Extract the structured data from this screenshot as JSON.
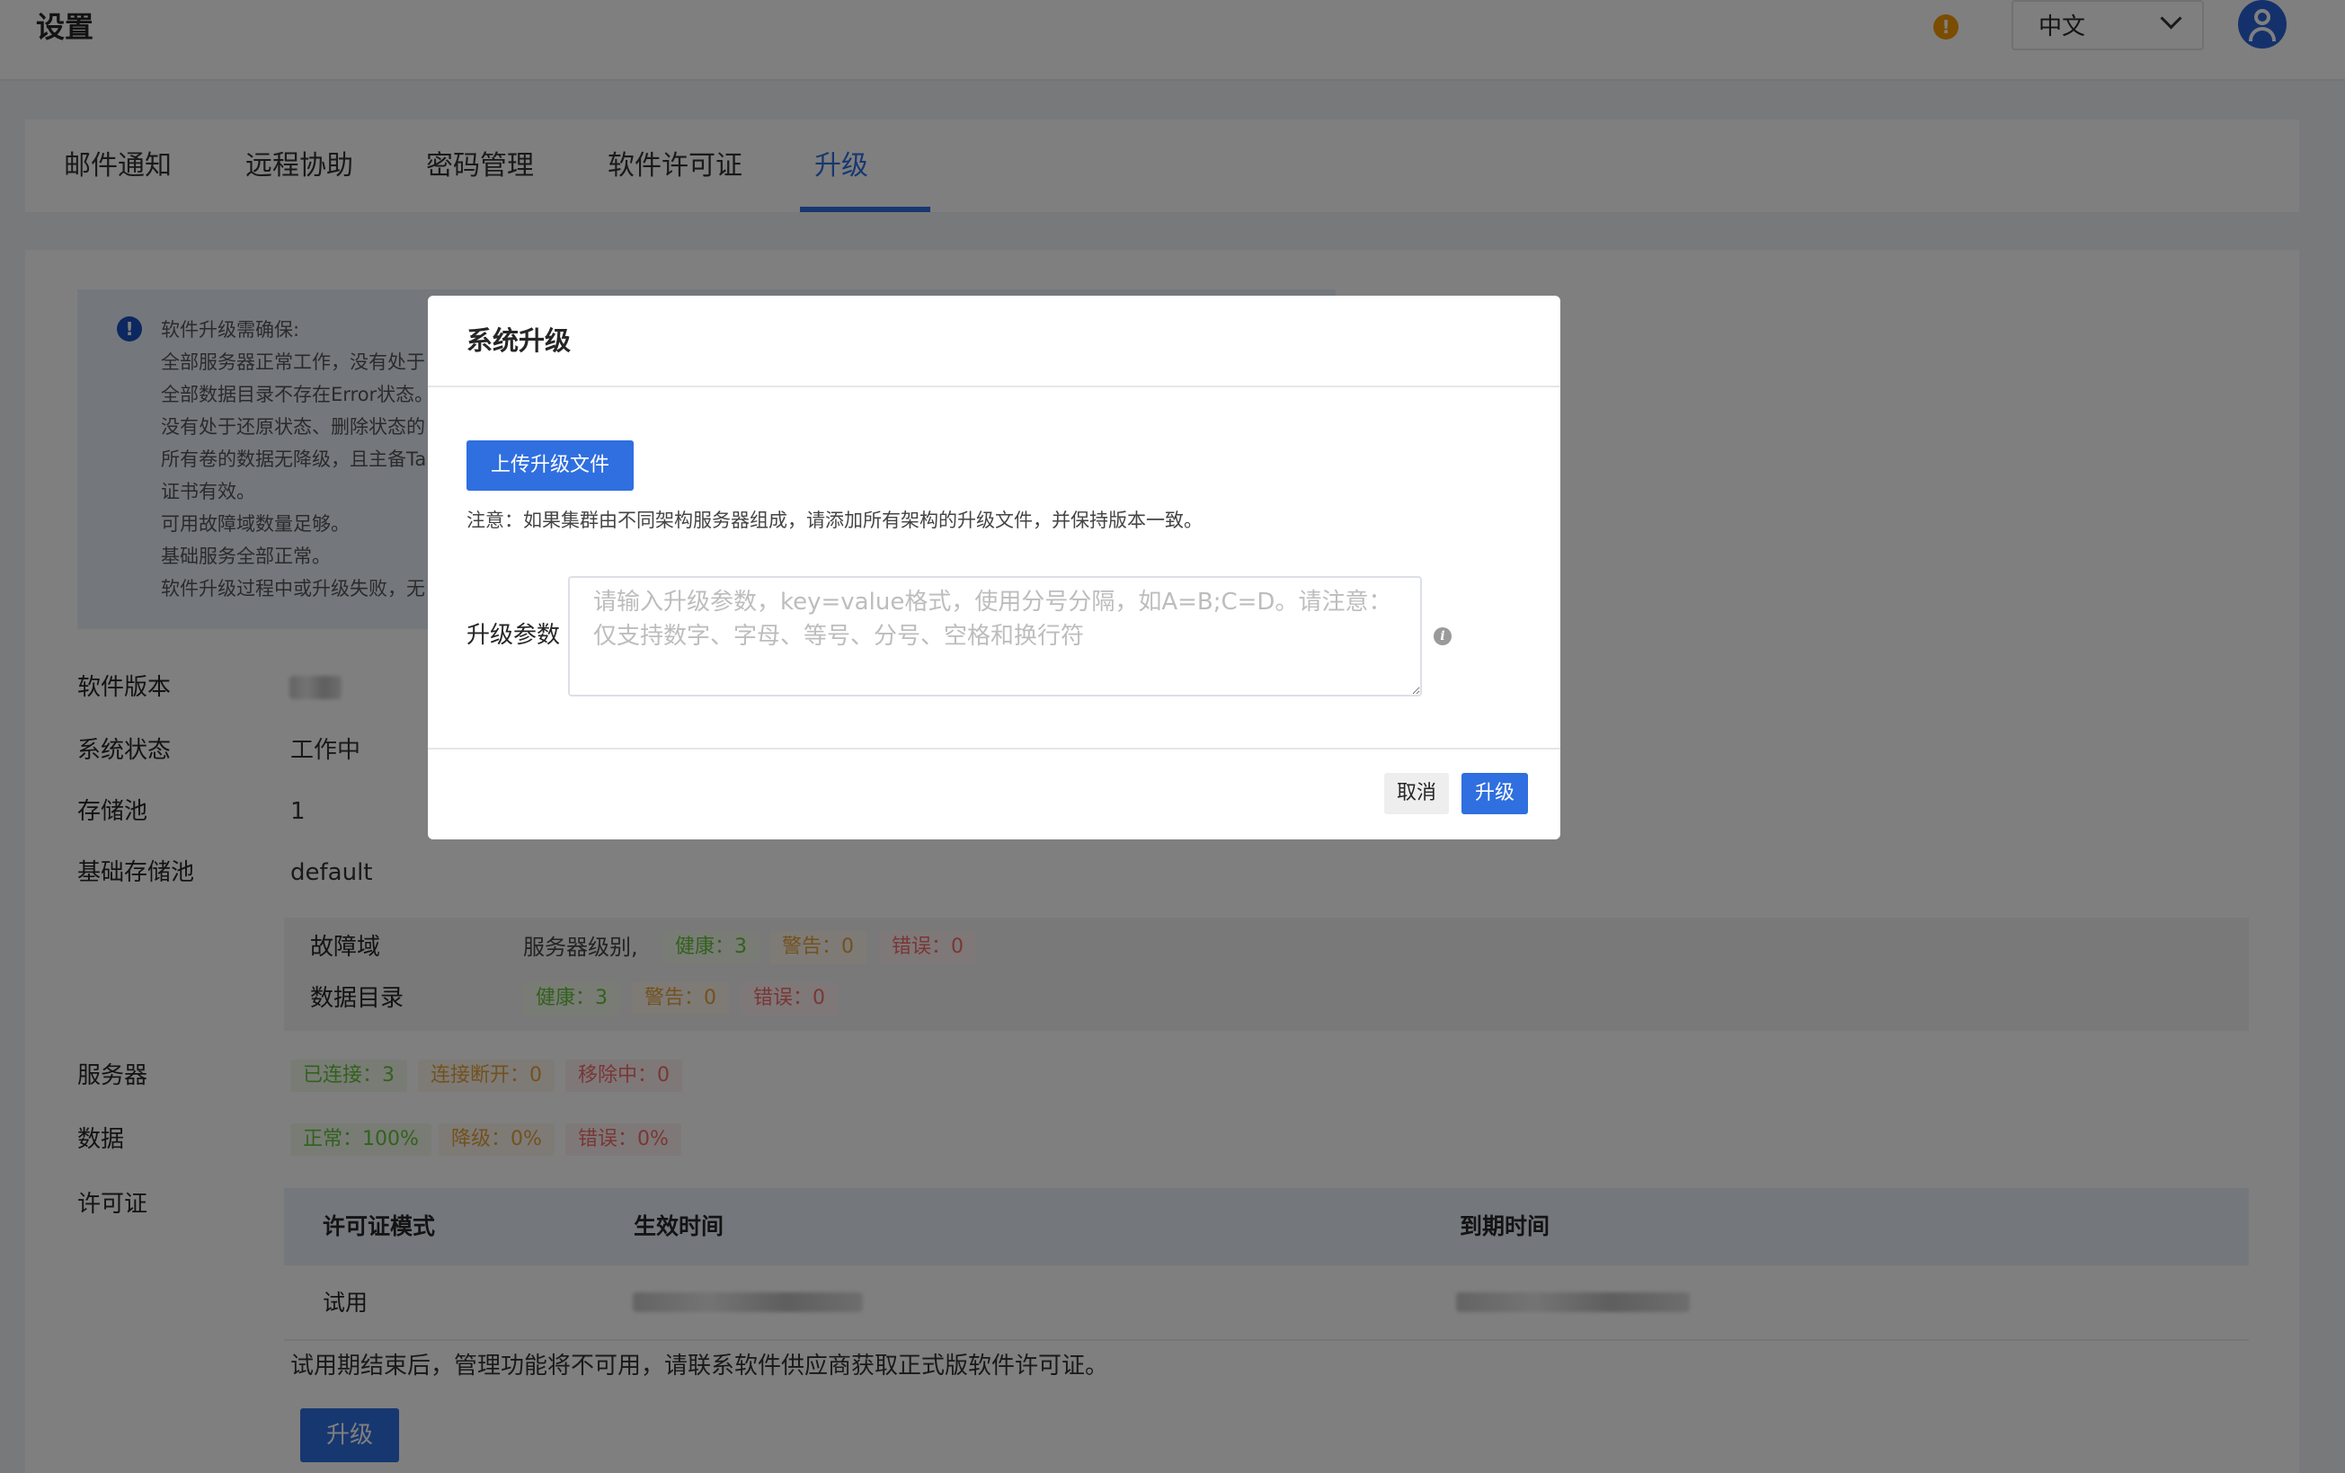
{
  "header": {
    "title": "设置",
    "language": "中文"
  },
  "tabs": [
    {
      "label": "邮件通知"
    },
    {
      "label": "远程协助"
    },
    {
      "label": "密码管理"
    },
    {
      "label": "软件许可证"
    },
    {
      "label": "升级",
      "active": true
    }
  ],
  "notice": {
    "lines": [
      "软件升级需确保:",
      "全部服务器正常工作，没有处于",
      "全部数据目录不存在Error状态。",
      "没有处于还原状态、删除状态的",
      "所有卷的数据无降级，且主备Ta",
      "证书有效。",
      "可用故障域数量足够。",
      "基础服务全部正常。",
      "软件升级过程中或升级失败，无"
    ]
  },
  "info": {
    "version_label": "软件版本",
    "status_label": "系统状态",
    "status_value": "工作中",
    "pool_label": "存储池",
    "pool_value": "1",
    "base_pool_label": "基础存储池",
    "base_pool_value": "default",
    "fault_domain_label": "故障域",
    "fault_domain_level": "服务器级别,",
    "fault_healthy": "健康：3",
    "fault_warning": "警告：0",
    "fault_error": "错误：0",
    "data_dir_label": "数据目录",
    "dir_healthy": "健康：3",
    "dir_warning": "警告：0",
    "dir_error": "错误：0",
    "server_label": "服务器",
    "server_connected": "已连接：3",
    "server_disconnected": "连接断开：0",
    "server_removing": "移除中：0",
    "data_label": "数据",
    "data_normal": "正常：100%",
    "data_degraded": "降级：0%",
    "data_error": "错误：0%",
    "license_label": "许可证"
  },
  "license_table": {
    "headers": [
      "许可证模式",
      "生效时间",
      "到期时间"
    ],
    "row": {
      "mode": "试用"
    }
  },
  "trial_note": "试用期结束后，管理功能将不可用，请联系软件供应商获取正式版软件许可证。",
  "upgrade_button": "升级",
  "modal": {
    "title": "系统升级",
    "upload_button": "上传升级文件",
    "note": "注意：如果集群由不同架构服务器组成，请添加所有架构的升级文件，并保持版本一致。",
    "param_label": "升级参数",
    "param_placeholder": "请输入升级参数，key=value格式，使用分号分隔，如A=B;C=D。请注意：仅支持数字、字母、等号、分号、空格和换行符",
    "cancel_button": "取消",
    "confirm_button": "升级"
  },
  "colors": {
    "accent": "#2f6fe0",
    "warning": "#f59a00",
    "success": "#67c23a",
    "danger": "#f56c6c",
    "caution": "#e6a23c"
  },
  "icons": [
    "warning-icon",
    "chevron-down-icon",
    "user-icon",
    "info-icon"
  ]
}
